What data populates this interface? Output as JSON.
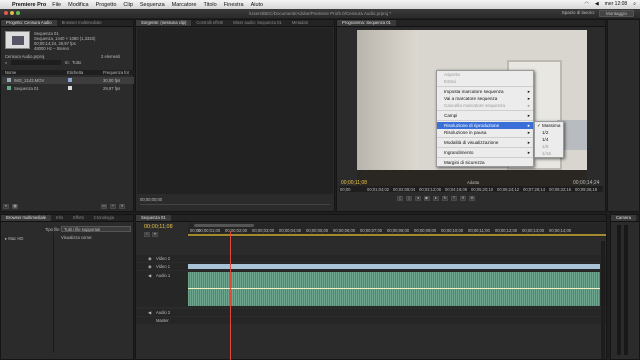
{
  "menubar": {
    "apple": "",
    "app": "Premiere Pro",
    "items": [
      "File",
      "Modifica",
      "Progetto",
      "Clip",
      "Sequenza",
      "Marcatore",
      "Titolo",
      "Finestra",
      "Aiuto"
    ],
    "clock": "mer 12:08"
  },
  "titlebar": {
    "path": "/Users/BEC/Documenti/Adobe/Premiere Pro/5.0/Censura Audio.prproj *",
    "workspace_label": "Spazio di lavoro:",
    "workspace_value": "Montaggio"
  },
  "project": {
    "tabs": [
      "Progetto: Censura Audio",
      "Browser multimediale"
    ],
    "seq_name": "Sequenza 01",
    "seq_info": [
      "Sequenza, 1440 × 1080 (1,3333)",
      "00;00;14;24, 29,97 fps",
      "48000 Hz – Stereo"
    ],
    "file": "Censura Audio.prproj",
    "count": "2 elementi",
    "in_label": "In:",
    "in_value": "Tutto",
    "col_name": "Nome",
    "col_tag": "Etichetta",
    "col_fps": "Frequenza fot",
    "items": [
      {
        "name": "IMG_2143.MOV",
        "fps": "30,00 fps"
      },
      {
        "name": "Sequenza 01",
        "fps": "29,97 fps"
      }
    ]
  },
  "source": {
    "tabs": [
      "Sorgente: (nessuna clip)",
      "Controlli effetti",
      "Mixer audio: Sequenza 01",
      "Metadati"
    ],
    "timecode": "00;00;00;00"
  },
  "program": {
    "tab": "Programma: Sequenza 01",
    "timecode_left": "00;00;11;08",
    "fit": "Adatta",
    "timecode_right": "00;00;14;24",
    "ruler": [
      "00;00",
      "00;01;04;02",
      "00;02;08;04",
      "00;03;12;06",
      "00;04;16;08",
      "00;05;20;10",
      "00;06;24;12",
      "00;07;28;14",
      "00;08;32;16",
      "00;09;36;18"
    ]
  },
  "context_menu": {
    "items": [
      {
        "label": "Asporta",
        "disabled": true
      },
      {
        "label": "Estrai",
        "disabled": true
      },
      {
        "label": "Imposta marcatore sequenza",
        "submenu": true
      },
      {
        "label": "Vai a marcatore sequenza",
        "submenu": true
      },
      {
        "label": "Cancella marcatore sequenza",
        "submenu": true,
        "disabled": true
      },
      {
        "label": "Campi",
        "submenu": true
      },
      {
        "label": "Risoluzione di riproduzione",
        "submenu": true,
        "highlight": true
      },
      {
        "label": "Risoluzione in pausa",
        "submenu": true
      },
      {
        "label": "Modalità di visualizzazione",
        "submenu": true
      },
      {
        "label": "Ingrandimento",
        "submenu": true
      },
      {
        "label": "Margini di sicurezza"
      }
    ],
    "submenu": [
      {
        "label": "Massima",
        "checked": true
      },
      {
        "label": "1/2"
      },
      {
        "label": "1/4"
      },
      {
        "label": "1/8",
        "disabled": true
      },
      {
        "label": "1/16",
        "disabled": true
      }
    ]
  },
  "browser": {
    "tabs": [
      "Browser multimediale",
      "Info",
      "Effetti",
      "Cronologia"
    ],
    "filetype_label": "Tipo file:",
    "filetype_value": "Tutti i file supportati",
    "view_label": "Visualizza come:",
    "tree_item": "Mac HD"
  },
  "timeline": {
    "tab": "Sequenza 01",
    "timecode": "00;00;11;08",
    "ruler": [
      "00;00",
      "00;00;01;00",
      "00;00;02;00",
      "00;00;03;00",
      "00;00;04;00",
      "00;00;05;00",
      "00;00;06;00",
      "00;00;07;00",
      "00;00;08;00",
      "00;00;09;00",
      "00;00;10;00",
      "00;00;11;00",
      "00;00;12;00",
      "00;00;13;00",
      "00;00;14;00"
    ],
    "tracks": [
      "Video 2",
      "Video 1",
      "Audio 1",
      "Audio 2",
      "Master"
    ]
  },
  "audiometer": {
    "tab": "Camera"
  }
}
